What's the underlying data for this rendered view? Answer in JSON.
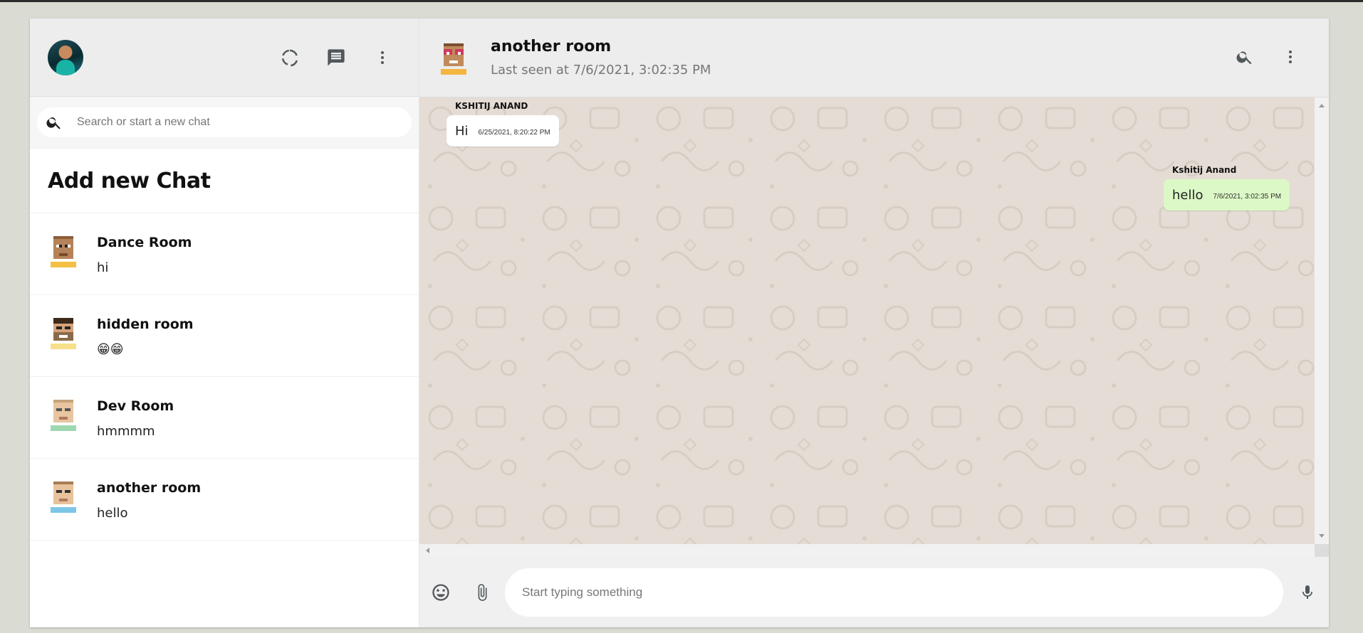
{
  "sidebar": {
    "header": {
      "avatar_alt": "user-avatar"
    },
    "search": {
      "placeholder": "Search or start a new chat"
    },
    "add_new_chat": "Add new Chat",
    "chats": [
      {
        "name": "Dance Room",
        "last_message": "hi"
      },
      {
        "name": "hidden room",
        "last_message": "😁😁"
      },
      {
        "name": "Dev Room",
        "last_message": "hmmmm"
      },
      {
        "name": "another room",
        "last_message": "hello"
      }
    ]
  },
  "chat": {
    "room_name": "another room",
    "last_seen": "Last seen at 7/6/2021, 3:02:35 PM",
    "messages": [
      {
        "sender": "KSHITIJ ANAND",
        "text": "Hi",
        "time": "6/25/2021, 8:20:22 PM",
        "own": false
      },
      {
        "sender": "Kshitij Anand",
        "text": "hello",
        "time": "7/6/2021, 3:02:35 PM",
        "own": true
      }
    ],
    "composer": {
      "placeholder": "Start typing something"
    }
  },
  "colors": {
    "header_bg": "#ededed",
    "chat_bg": "#e5ddd5",
    "own_bubble": "#dcf8c6",
    "other_bubble": "#ffffff"
  }
}
